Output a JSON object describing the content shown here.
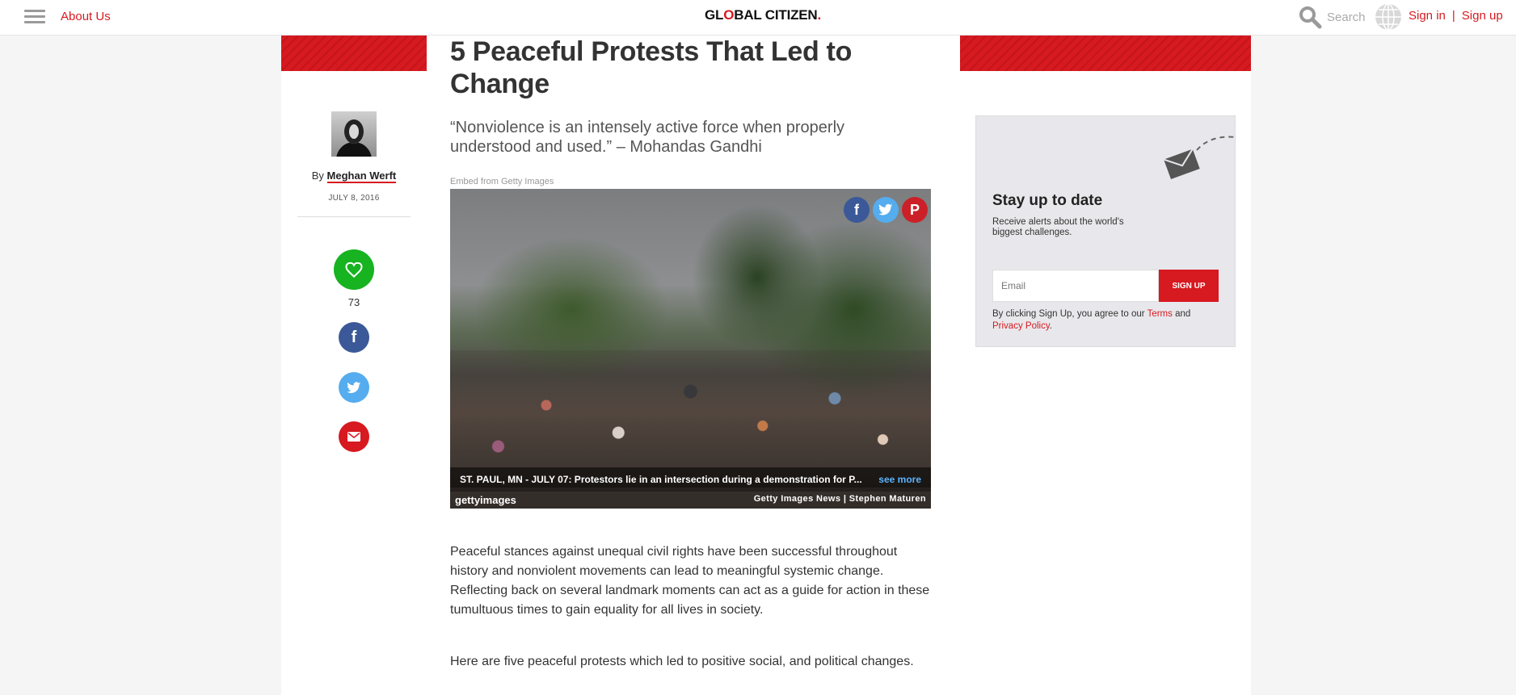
{
  "header": {
    "menu_icon": "hamburger-menu-icon",
    "about_label": "About Us",
    "logo_pre": "GL",
    "logo_o": "O",
    "logo_post": "BAL CITIZEN",
    "logo_dot": ".",
    "search_label": "Search",
    "signin_label": "Sign in",
    "separator": "|",
    "signup_label": "Sign up"
  },
  "article": {
    "title": "5 Peaceful Protests That Led to Change",
    "quote": "“Nonviolence is an intensely active force when properly understood and used.” – Mohandas Gandhi",
    "embed_label": "Embed from Getty Images",
    "photo": {
      "caption": "ST. PAUL, MN - JULY 07: Protestors lie in an intersection during a demonstration for P...",
      "see_more": "see more",
      "brand": "gettyimages",
      "credit": "Getty Images News | Stephen Maturen",
      "share_icons": [
        "facebook-icon",
        "twitter-icon",
        "pinterest-icon"
      ]
    },
    "paragraph1": "Peaceful stances against unequal civil rights have been successful throughout history and nonviolent movements can lead to meaningful systemic change. Reflecting back on several landmark moments can act as a guide for action in these tumultuous times to gain equality for all lives in society.",
    "paragraph2": "Here are five peaceful protests which led to positive social, and political changes."
  },
  "author": {
    "by": "By",
    "name": "Meghan Werft",
    "date": "JULY 8, 2016",
    "likes": "73"
  },
  "newsletter": {
    "heading": "Stay up to date",
    "text": "Receive alerts about the world's biggest challenges.",
    "email_placeholder": "Email",
    "signup_label": "SIGN UP",
    "terms_pre": "By clicking Sign Up, you agree to our ",
    "terms_link": "Terms",
    "terms_mid": " and",
    "privacy_link": "Privacy Policy",
    "terms_end": "."
  },
  "colors": {
    "brand_red": "#d71920",
    "like_green": "#17b320",
    "facebook_blue": "#3b5998",
    "twitter_blue": "#55acee"
  }
}
